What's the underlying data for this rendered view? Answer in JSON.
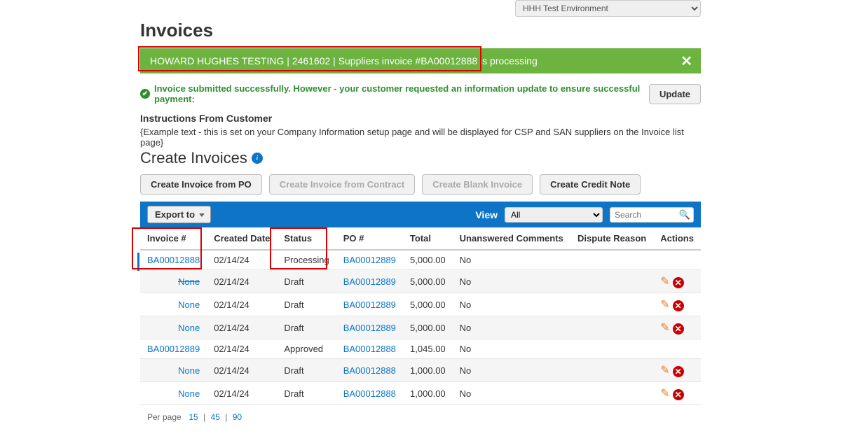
{
  "env_selector": "HHH Test Environment",
  "page_title": "Invoices",
  "banner": {
    "text": "HOWARD HUGHES TESTING | 2461602 | Suppliers invoice #BA00012888 is processing"
  },
  "info": {
    "message": "Invoice submitted successfully. However - your customer requested an information update to ensure successful payment:",
    "update_btn": "Update"
  },
  "instructions": {
    "heading": "Instructions From Customer",
    "text": "{Example text - this is set on your Company Information setup page and will be displayed for CSP and SAN suppliers on the Invoice list page}"
  },
  "create_title": "Create Invoices",
  "create_buttons": {
    "from_po": "Create Invoice from PO",
    "from_contract": "Create Invoice from Contract",
    "blank": "Create Blank Invoice",
    "credit_note": "Create Credit Note"
  },
  "toolbar": {
    "export_label": "Export to",
    "view_label": "View",
    "view_value": "All",
    "search_placeholder": "Search"
  },
  "columns": {
    "invoice": "Invoice #",
    "created": "Created Date",
    "status": "Status",
    "po": "PO #",
    "total": "Total",
    "unanswered": "Unanswered Comments",
    "dispute": "Dispute Reason",
    "actions": "Actions"
  },
  "rows": [
    {
      "invoice": "BA00012888",
      "created": "02/14/24",
      "status": "Processing",
      "po": "BA00012889",
      "total": "5,000.00",
      "unanswered": "No",
      "dispute": "",
      "has_actions": false,
      "strike": false
    },
    {
      "invoice": "None",
      "created": "02/14/24",
      "status": "Draft",
      "po": "BA00012889",
      "total": "5,000.00",
      "unanswered": "No",
      "dispute": "",
      "has_actions": true,
      "strike": true
    },
    {
      "invoice": "None",
      "created": "02/14/24",
      "status": "Draft",
      "po": "BA00012889",
      "total": "5,000.00",
      "unanswered": "No",
      "dispute": "",
      "has_actions": true,
      "strike": false
    },
    {
      "invoice": "None",
      "created": "02/14/24",
      "status": "Draft",
      "po": "BA00012889",
      "total": "5,000.00",
      "unanswered": "No",
      "dispute": "",
      "has_actions": true,
      "strike": false
    },
    {
      "invoice": "BA00012889",
      "created": "02/14/24",
      "status": "Approved",
      "po": "BA00012888",
      "total": "1,045.00",
      "unanswered": "No",
      "dispute": "",
      "has_actions": false,
      "strike": false
    },
    {
      "invoice": "None",
      "created": "02/14/24",
      "status": "Draft",
      "po": "BA00012888",
      "total": "1,000.00",
      "unanswered": "No",
      "dispute": "",
      "has_actions": true,
      "strike": false
    },
    {
      "invoice": "None",
      "created": "02/14/24",
      "status": "Draft",
      "po": "BA00012888",
      "total": "1,000.00",
      "unanswered": "No",
      "dispute": "",
      "has_actions": true,
      "strike": false
    }
  ],
  "per_page": {
    "label": "Per page",
    "options": [
      "15",
      "45",
      "90"
    ]
  }
}
